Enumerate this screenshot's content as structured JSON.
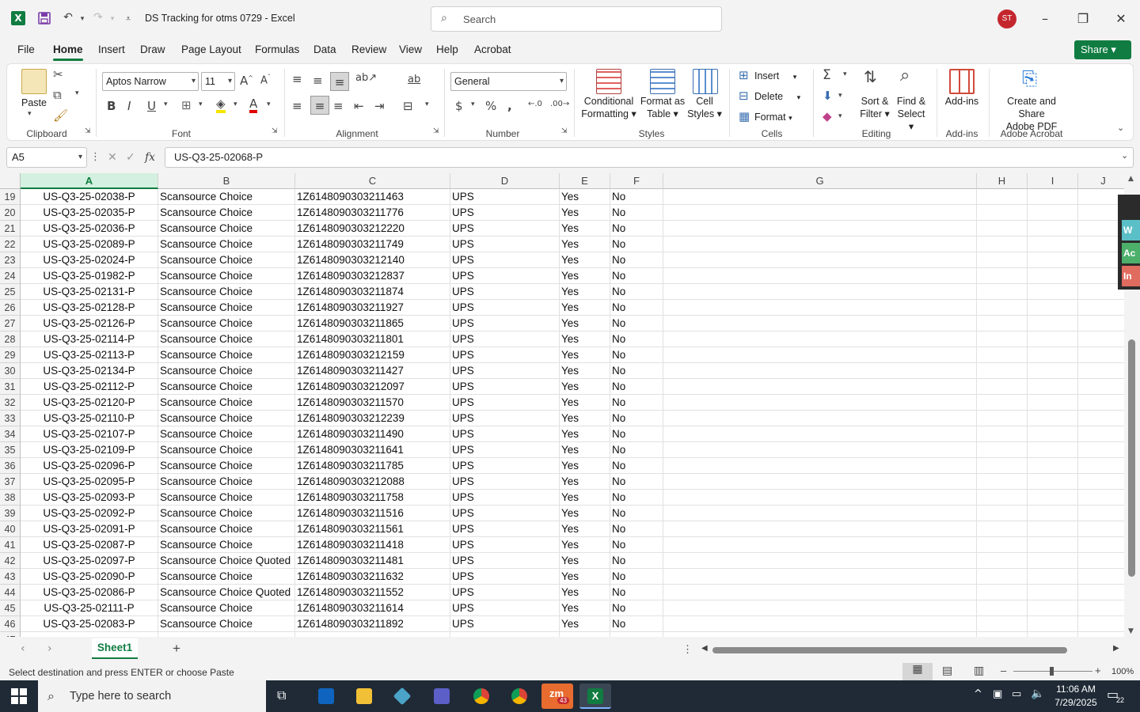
{
  "titlebar": {
    "doc_title": "DS Tracking for otms 0729  -  Excel",
    "search_placeholder": "Search",
    "avatar_initials": "ST"
  },
  "menu": {
    "tabs": [
      "File",
      "Home",
      "Insert",
      "Draw",
      "Page Layout",
      "Formulas",
      "Data",
      "Review",
      "View",
      "Help",
      "Acrobat"
    ],
    "active": "Home",
    "share_label": "Share"
  },
  "ribbon": {
    "clipboard": {
      "label": "Clipboard",
      "paste": "Paste"
    },
    "font": {
      "label": "Font",
      "font_name": "Aptos Narrow",
      "font_size": "11"
    },
    "alignment": {
      "label": "Alignment"
    },
    "number": {
      "label": "Number",
      "format": "General"
    },
    "styles": {
      "label": "Styles",
      "conditional": "Conditional",
      "formatting": "Formatting",
      "format_as": "Format as",
      "table": "Table",
      "cell": "Cell",
      "cell_styles": "Styles"
    },
    "cells": {
      "label": "Cells",
      "insert": "Insert",
      "delete": "Delete",
      "format": "Format"
    },
    "editing": {
      "label": "Editing",
      "sort": "Sort &",
      "filter": "Filter",
      "find": "Find &",
      "select": "Select"
    },
    "addins": {
      "label": "Add-ins",
      "button": "Add-ins"
    },
    "acrobat": {
      "label": "Adobe Acrobat",
      "line1": "Create and Share",
      "line2": "Adobe PDF"
    }
  },
  "formula_bar": {
    "name_box": "A5",
    "fx": "fx",
    "formula": "US-Q3-25-02068-P"
  },
  "columns": [
    "A",
    "B",
    "C",
    "D",
    "E",
    "F",
    "G",
    "H",
    "I",
    "J"
  ],
  "selected_column": "A",
  "rows": [
    {
      "n": "19",
      "a": "US-Q3-25-02038-P",
      "b": "Scansource Choice",
      "c": "1Z6148090303211463",
      "d": "UPS",
      "e": "Yes",
      "f": "No"
    },
    {
      "n": "20",
      "a": "US-Q3-25-02035-P",
      "b": "Scansource Choice",
      "c": "1Z6148090303211776",
      "d": "UPS",
      "e": "Yes",
      "f": "No"
    },
    {
      "n": "21",
      "a": "US-Q3-25-02036-P",
      "b": "Scansource Choice",
      "c": "1Z6148090303212220",
      "d": "UPS",
      "e": "Yes",
      "f": "No"
    },
    {
      "n": "22",
      "a": "US-Q3-25-02089-P",
      "b": "Scansource Choice",
      "c": "1Z6148090303211749",
      "d": "UPS",
      "e": "Yes",
      "f": "No"
    },
    {
      "n": "23",
      "a": "US-Q3-25-02024-P",
      "b": "Scansource Choice",
      "c": "1Z6148090303212140",
      "d": "UPS",
      "e": "Yes",
      "f": "No"
    },
    {
      "n": "24",
      "a": "US-Q3-25-01982-P",
      "b": "Scansource Choice",
      "c": "1Z6148090303212837",
      "d": "UPS",
      "e": "Yes",
      "f": "No"
    },
    {
      "n": "25",
      "a": "US-Q3-25-02131-P",
      "b": "Scansource Choice",
      "c": "1Z6148090303211874",
      "d": "UPS",
      "e": "Yes",
      "f": "No"
    },
    {
      "n": "26",
      "a": "US-Q3-25-02128-P",
      "b": "Scansource Choice",
      "c": "1Z6148090303211927",
      "d": "UPS",
      "e": "Yes",
      "f": "No"
    },
    {
      "n": "27",
      "a": "US-Q3-25-02126-P",
      "b": "Scansource Choice",
      "c": "1Z6148090303211865",
      "d": "UPS",
      "e": "Yes",
      "f": "No"
    },
    {
      "n": "28",
      "a": "US-Q3-25-02114-P",
      "b": "Scansource Choice",
      "c": "1Z6148090303211801",
      "d": "UPS",
      "e": "Yes",
      "f": "No"
    },
    {
      "n": "29",
      "a": "US-Q3-25-02113-P",
      "b": "Scansource Choice",
      "c": "1Z6148090303212159",
      "d": "UPS",
      "e": "Yes",
      "f": "No"
    },
    {
      "n": "30",
      "a": "US-Q3-25-02134-P",
      "b": "Scansource Choice",
      "c": "1Z6148090303211427",
      "d": "UPS",
      "e": "Yes",
      "f": "No"
    },
    {
      "n": "31",
      "a": "US-Q3-25-02112-P",
      "b": "Scansource Choice",
      "c": "1Z6148090303212097",
      "d": "UPS",
      "e": "Yes",
      "f": "No"
    },
    {
      "n": "32",
      "a": "US-Q3-25-02120-P",
      "b": "Scansource Choice",
      "c": "1Z6148090303211570",
      "d": "UPS",
      "e": "Yes",
      "f": "No"
    },
    {
      "n": "33",
      "a": "US-Q3-25-02110-P",
      "b": "Scansource Choice",
      "c": "1Z6148090303212239",
      "d": "UPS",
      "e": "Yes",
      "f": "No"
    },
    {
      "n": "34",
      "a": "US-Q3-25-02107-P",
      "b": "Scansource Choice",
      "c": "1Z6148090303211490",
      "d": "UPS",
      "e": "Yes",
      "f": "No"
    },
    {
      "n": "35",
      "a": "US-Q3-25-02109-P",
      "b": "Scansource Choice",
      "c": "1Z6148090303211641",
      "d": "UPS",
      "e": "Yes",
      "f": "No"
    },
    {
      "n": "36",
      "a": "US-Q3-25-02096-P",
      "b": "Scansource Choice",
      "c": "1Z6148090303211785",
      "d": "UPS",
      "e": "Yes",
      "f": "No"
    },
    {
      "n": "37",
      "a": "US-Q3-25-02095-P",
      "b": "Scansource Choice",
      "c": "1Z6148090303212088",
      "d": "UPS",
      "e": "Yes",
      "f": "No"
    },
    {
      "n": "38",
      "a": "US-Q3-25-02093-P",
      "b": "Scansource Choice",
      "c": "1Z6148090303211758",
      "d": "UPS",
      "e": "Yes",
      "f": "No"
    },
    {
      "n": "39",
      "a": "US-Q3-25-02092-P",
      "b": "Scansource Choice",
      "c": "1Z6148090303211516",
      "d": "UPS",
      "e": "Yes",
      "f": "No"
    },
    {
      "n": "40",
      "a": "US-Q3-25-02091-P",
      "b": "Scansource Choice",
      "c": "1Z6148090303211561",
      "d": "UPS",
      "e": "Yes",
      "f": "No"
    },
    {
      "n": "41",
      "a": "US-Q3-25-02087-P",
      "b": "Scansource Choice",
      "c": "1Z6148090303211418",
      "d": "UPS",
      "e": "Yes",
      "f": "No"
    },
    {
      "n": "42",
      "a": "US-Q3-25-02097-P",
      "b": "Scansource Choice Quoted",
      "c": "1Z6148090303211481",
      "d": "UPS",
      "e": "Yes",
      "f": "No"
    },
    {
      "n": "43",
      "a": "US-Q3-25-02090-P",
      "b": "Scansource Choice",
      "c": "1Z6148090303211632",
      "d": "UPS",
      "e": "Yes",
      "f": "No"
    },
    {
      "n": "44",
      "a": "US-Q3-25-02086-P",
      "b": "Scansource Choice Quoted",
      "c": "1Z6148090303211552",
      "d": "UPS",
      "e": "Yes",
      "f": "No"
    },
    {
      "n": "45",
      "a": "US-Q3-25-02111-P",
      "b": "Scansource Choice",
      "c": "1Z6148090303211614",
      "d": "UPS",
      "e": "Yes",
      "f": "No"
    },
    {
      "n": "46",
      "a": "US-Q3-25-02083-P",
      "b": "Scansource Choice",
      "c": "1Z6148090303211892",
      "d": "UPS",
      "e": "Yes",
      "f": "No"
    },
    {
      "n": "47",
      "a": "",
      "b": "",
      "c": "",
      "d": "",
      "e": "",
      "f": ""
    }
  ],
  "side_tabs": [
    {
      "text": "W",
      "color": "#5bbfc7"
    },
    {
      "text": "Ac",
      "color": "#4caf6a"
    },
    {
      "text": "In",
      "color": "#e06b5f"
    }
  ],
  "sheets": {
    "active": "Sheet1",
    "add_label": "+"
  },
  "status": {
    "message": "Select destination and press ENTER or choose Paste",
    "zoom": "100%"
  },
  "taskbar": {
    "search_placeholder": "Type here to search",
    "time": "11:06 AM",
    "date": "7/29/2025",
    "notifications": "22",
    "zoom_badge": "43"
  },
  "colors": {
    "accent": "#107c41",
    "avatar": "#c4262e"
  }
}
